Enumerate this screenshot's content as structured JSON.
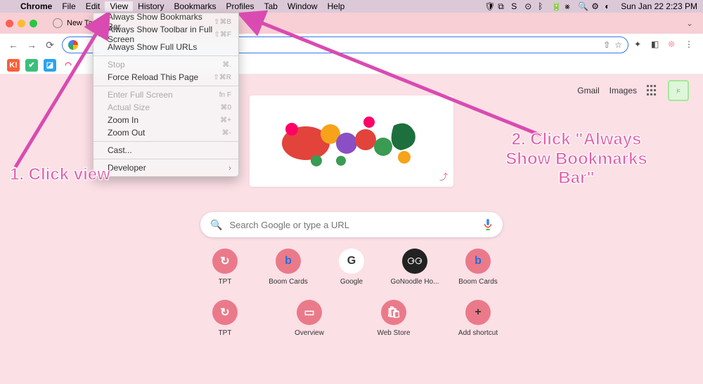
{
  "menubar": {
    "app": "Chrome",
    "items": [
      "File",
      "Edit",
      "View",
      "History",
      "Bookmarks",
      "Profiles",
      "Tab",
      "Window",
      "Help"
    ],
    "open": "View",
    "clock": "Sun Jan 22  2:23 PM"
  },
  "viewmenu": {
    "items": [
      {
        "label": "Always Show Bookmarks Bar",
        "kb": "⇧⌘B",
        "checked": false
      },
      {
        "label": "Always Show Toolbar in Full Screen",
        "kb": "⇧⌘F",
        "checked": true
      },
      {
        "label": "Always Show Full URLs",
        "kb": "",
        "checked": false
      },
      {
        "sep": true
      },
      {
        "label": "Stop",
        "kb": "⌘.",
        "disabled": true
      },
      {
        "label": "Force Reload This Page",
        "kb": "⇧⌘R"
      },
      {
        "sep": true
      },
      {
        "label": "Enter Full Screen",
        "kb": "fn F",
        "disabled": true
      },
      {
        "label": "Actual Size",
        "kb": "⌘0",
        "disabled": true
      },
      {
        "label": "Zoom In",
        "kb": "⌘+"
      },
      {
        "label": "Zoom Out",
        "kb": "⌘-"
      },
      {
        "sep": true
      },
      {
        "label": "Cast..."
      },
      {
        "sep": true
      },
      {
        "label": "Developer",
        "submenu": true
      }
    ]
  },
  "tab": {
    "title": "New Tab"
  },
  "toolbar": {
    "back": "←",
    "fwd": "→",
    "reload": "⟳"
  },
  "bookmarks": [
    {
      "glyph": "K!",
      "bg": "#fa5f3a",
      "fg": "#fff",
      "name": "kahoot"
    },
    {
      "glyph": "✔",
      "bg": "#3bbf7a",
      "fg": "#fff",
      "name": "check"
    },
    {
      "glyph": "◪",
      "bg": "#2aa3ef",
      "fg": "#fff",
      "name": "blue"
    },
    {
      "glyph": "◠",
      "bg": "",
      "fg": "#e36",
      "name": "rainbow"
    }
  ],
  "topright": {
    "gmail": "Gmail",
    "images": "Images"
  },
  "search": {
    "placeholder": "Search Google or type a URL"
  },
  "shortcuts_row1": [
    {
      "label": "TPT",
      "glyph": "↻",
      "style": "pink"
    },
    {
      "label": "Boom Cards",
      "glyph": "b",
      "style": "pink",
      "fg": "#1b6fe0"
    },
    {
      "label": "Google",
      "glyph": "G",
      "style": "white"
    },
    {
      "label": "GoNoodle Ho...",
      "glyph": "⚆⚆",
      "style": "dark"
    },
    {
      "label": "Boom Cards",
      "glyph": "b",
      "style": "pink",
      "fg": "#1b6fe0"
    }
  ],
  "shortcuts_row2": [
    {
      "label": "TPT",
      "glyph": "↻",
      "style": "pink"
    },
    {
      "label": "Overview",
      "glyph": "▭",
      "style": "pink"
    },
    {
      "label": "Web Store",
      "glyph": "🛍",
      "style": "pink"
    },
    {
      "label": "Add shortcut",
      "glyph": "+",
      "style": "pink",
      "fg": "#333"
    }
  ],
  "annotations": {
    "step1": "1. Click view",
    "step2": "2. Click \"Always Show Bookmarks Bar\""
  }
}
